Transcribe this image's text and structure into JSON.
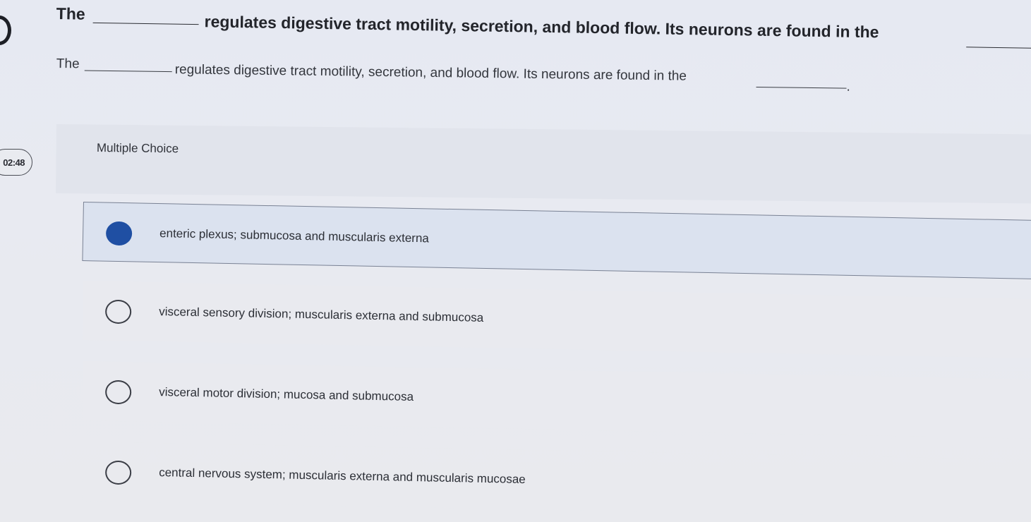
{
  "timer": {
    "text": "02:48"
  },
  "question_zoom": {
    "word_start": "The",
    "rest": "regulates digestive tract motility, secretion, and blood flow. Its neurons are found in the"
  },
  "question": {
    "word_start": "The",
    "rest": "regulates digestive tract motility, secretion, and blood flow. Its neurons are found in the",
    "end": "."
  },
  "section_label": "Multiple Choice",
  "options": [
    {
      "text": "enteric plexus; submucosa and muscularis externa",
      "selected": true
    },
    {
      "text": "visceral sensory division; muscularis externa and submucosa",
      "selected": false
    },
    {
      "text": "visceral motor division; mucosa and submucosa",
      "selected": false
    },
    {
      "text": "central nervous system; muscularis externa and muscularis mucosae",
      "selected": false
    }
  ],
  "colors": {
    "selected_radio": "#1f4fa3",
    "selected_bg": "#dbe2ef"
  }
}
